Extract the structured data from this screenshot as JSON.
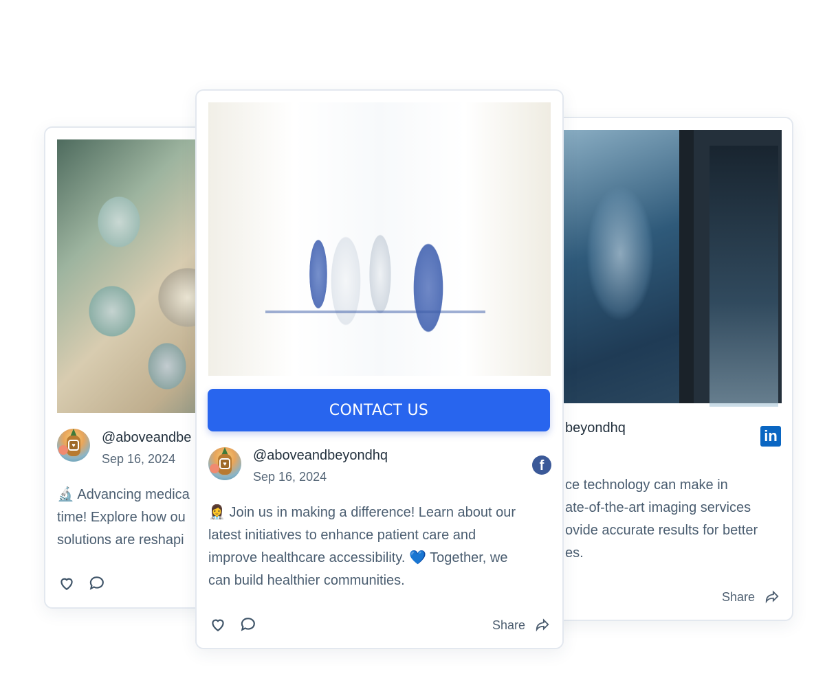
{
  "cards": [
    {
      "handle": "@aboveandbe",
      "date": "Sep 16, 2024",
      "text_lines": [
        "🔬 Advancing medica",
        "time! Explore how ou",
        "solutions are reshapi"
      ],
      "image_alt": "Surgeons in masks looking down",
      "actions": {
        "like": "like",
        "comment": "comment"
      }
    },
    {
      "handle": "@aboveandbeyondhq",
      "date": "Sep 16, 2024",
      "network": "facebook",
      "cta_label": "CONTACT US",
      "text_lines": [
        "👩‍⚕️ Join us in making a difference! Learn about our",
        "latest initiatives to enhance patient care and",
        "improve healthcare accessibility. 💙 Together, we",
        "can build healthier communities."
      ],
      "image_alt": "Medical staff walking down hospital corridor",
      "share_label": "Share"
    },
    {
      "handle": "beyondhq",
      "network": "linkedin",
      "text_lines": [
        "ce technology can make in",
        "ate-of-the-art imaging services",
        "ovide accurate results for better",
        "es."
      ],
      "image_alt": "X-ray of hand making OK gesture",
      "share_label": "Share"
    }
  ],
  "colors": {
    "cta": "#2865ee",
    "facebook": "#3b5998",
    "linkedin": "#0a66c2",
    "text": "#4a5d70"
  }
}
